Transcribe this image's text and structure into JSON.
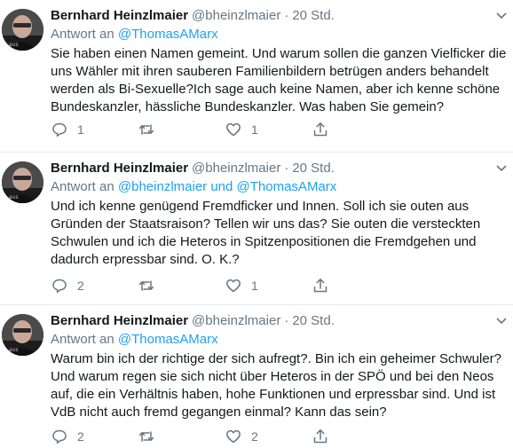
{
  "tweets": [
    {
      "name": "Bernhard Heinzlmaier",
      "handle": "@bheinzlmaier",
      "separator": "·",
      "time": "20 Std.",
      "reply_prefix": "Antwort an",
      "reply_mentions": "@ThomasAMarx",
      "text": "Sie haben einen Namen gemeint. Und warum sollen die ganzen Vielficker die uns Wähler mit ihren sauberen Familienbildern betrügen anders behandelt werden als Bi-Sexuelle?Ich sage auch keine Namen, aber ich kenne schöne Bundeskanzler, hässliche Bundeskanzler. Was haben Sie gemein?",
      "replies": "1",
      "retweets": "",
      "likes": "1"
    },
    {
      "name": "Bernhard Heinzlmaier",
      "handle": "@bheinzlmaier",
      "separator": "·",
      "time": "20 Std.",
      "reply_prefix": "Antwort an",
      "reply_mentions": "@bheinzlmaier und @ThomasAMarx",
      "text": "Und ich kenne genügend Fremdficker und Innen. Soll ich sie outen aus Gründen der Staatsraison? Tellen wir uns das? Sie outen die versteckten Schwulen und ich die Heteros in Spitzenpositionen die Fremdgehen und dadurch erpressbar sind. O. K.?",
      "replies": "2",
      "retweets": "",
      "likes": "1"
    },
    {
      "name": "Bernhard Heinzlmaier",
      "handle": "@bheinzlmaier",
      "separator": "·",
      "time": "20 Std.",
      "reply_prefix": "Antwort an",
      "reply_mentions": "@ThomasAMarx",
      "text": "Warum bin ich der richtige der sich aufregt?. Bin ich ein geheimer Schwuler? Und warum regen sie sich nicht über Heteros in der SPÖ und bei den Neos auf, die ein Verhältnis haben, hohe Funktionen und erpressbar sind. Und ist VdB nicht auch fremd gegangen einmal? Kann das sein?",
      "replies": "2",
      "retweets": "",
      "likes": "2"
    }
  ],
  "colors": {
    "text": "#14171a",
    "secondary": "#657786",
    "link": "#1da1f2",
    "divider": "#e6ecf0"
  },
  "icons": [
    "reply-icon",
    "retweet-icon",
    "like-icon",
    "share-icon",
    "chevron-down-icon"
  ]
}
